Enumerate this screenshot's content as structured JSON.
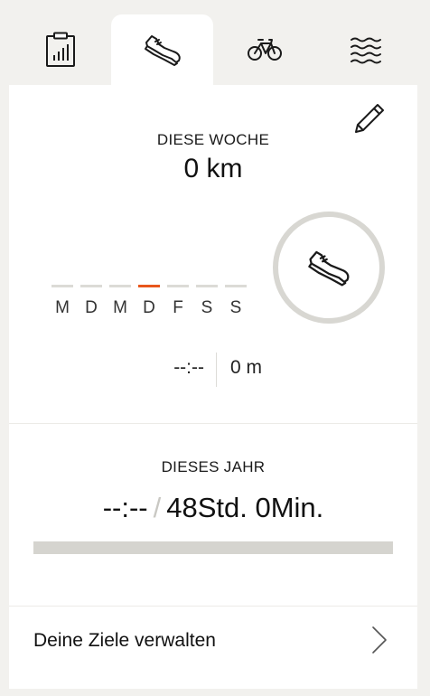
{
  "tabs": [
    {
      "id": "overview",
      "icon": "clipboard-chart-icon",
      "active": false
    },
    {
      "id": "running",
      "icon": "shoe-icon",
      "active": true
    },
    {
      "id": "cycling",
      "icon": "bicycle-icon",
      "active": false
    },
    {
      "id": "swimming",
      "icon": "waves-icon",
      "active": false
    }
  ],
  "week": {
    "title": "DIESE WOCHE",
    "distance": "0 km",
    "days": [
      {
        "label": "M",
        "current": false
      },
      {
        "label": "D",
        "current": false
      },
      {
        "label": "M",
        "current": false
      },
      {
        "label": "D",
        "current": true
      },
      {
        "label": "F",
        "current": false
      },
      {
        "label": "S",
        "current": false
      },
      {
        "label": "S",
        "current": false
      }
    ],
    "duration": "--:--",
    "elevation": "0 m",
    "ring_progress": 0
  },
  "year": {
    "title": "DIESES JAHR",
    "current": "--:--",
    "separator": "/",
    "goal": "48Std. 0Min.",
    "progress": 0
  },
  "manage": {
    "label": "Deine Ziele verwalten"
  },
  "colors": {
    "accent": "#e8561c",
    "track": "#d5d4cf",
    "background": "#f2f1ee"
  }
}
